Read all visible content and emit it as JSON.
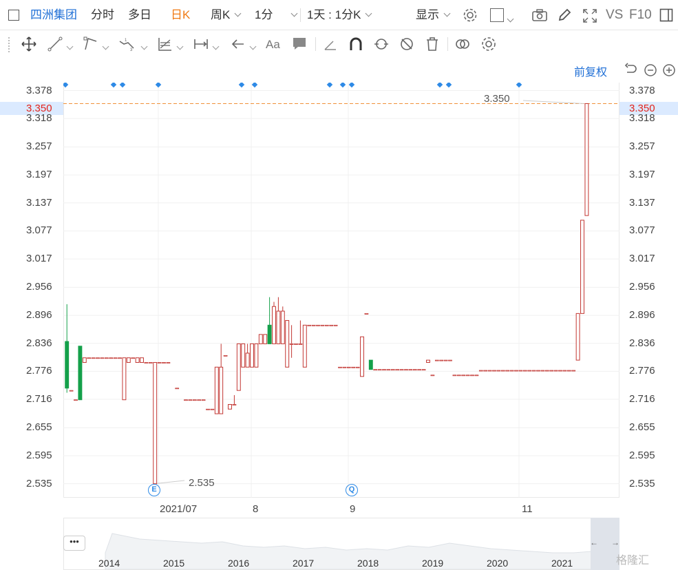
{
  "toolbar": {
    "stock_name": "四洲集团",
    "tab_intraday": "分时",
    "tab_multiday": "多日",
    "tab_daily": "日K",
    "tab_weekly": "周K",
    "tab_minute": "1分",
    "period_combo": "1天 : 1分K",
    "display_label": "显示",
    "vs_label": "VS",
    "f10_label": "F10"
  },
  "chart_toolbar": {
    "adjust_label": "前复权"
  },
  "y_axis": {
    "ticks": [
      "3.378",
      "3.318",
      "3.257",
      "3.197",
      "3.137",
      "3.077",
      "3.017",
      "2.956",
      "2.896",
      "2.836",
      "2.776",
      "2.716",
      "2.655",
      "2.595",
      "2.535"
    ],
    "current_price": "3.350"
  },
  "x_axis": {
    "ticks": [
      "2021/07",
      "8",
      "9",
      "11"
    ]
  },
  "annotations": {
    "high_label": "3.350",
    "low_label": "2.535",
    "event_e": "E",
    "event_q": "Q"
  },
  "navigator": {
    "more": "•••",
    "years": [
      "2014",
      "2015",
      "2016",
      "2017",
      "2018",
      "2019",
      "2020",
      "2021"
    ],
    "left_arrow": "←",
    "right_arrow": "→"
  },
  "watermark": "格隆汇",
  "colors": {
    "up": "#c23531",
    "down": "#14a04a",
    "accent": "#1f6fd6",
    "active_tab": "#f07a13",
    "price_line": "#f09038",
    "price_text": "#e2231a"
  },
  "chart_data": {
    "type": "candlestick",
    "ylim": [
      2.505,
      3.395
    ],
    "candles": [
      {
        "x": 0,
        "o": 2.84,
        "h": 2.92,
        "l": 2.73,
        "c": 2.74
      },
      {
        "x": 1,
        "o": 2.735,
        "h": 2.735,
        "l": 2.735,
        "c": 2.735
      },
      {
        "x": 2,
        "o": 2.715,
        "h": 2.715,
        "l": 2.715,
        "c": 2.715
      },
      {
        "x": 3,
        "o": 2.83,
        "h": 2.83,
        "l": 2.715,
        "c": 2.715
      },
      {
        "x": 4,
        "o": 2.795,
        "h": 2.805,
        "l": 2.795,
        "c": 2.805
      },
      {
        "x": 5,
        "o": 2.805,
        "h": 2.805,
        "l": 2.805,
        "c": 2.805
      },
      {
        "x": 6,
        "o": 2.805,
        "h": 2.805,
        "l": 2.805,
        "c": 2.805
      },
      {
        "x": 7,
        "o": 2.805,
        "h": 2.805,
        "l": 2.805,
        "c": 2.805
      },
      {
        "x": 8,
        "o": 2.805,
        "h": 2.805,
        "l": 2.805,
        "c": 2.805
      },
      {
        "x": 9,
        "o": 2.805,
        "h": 2.805,
        "l": 2.805,
        "c": 2.805
      },
      {
        "x": 10,
        "o": 2.805,
        "h": 2.805,
        "l": 2.805,
        "c": 2.805
      },
      {
        "x": 11,
        "o": 2.805,
        "h": 2.805,
        "l": 2.805,
        "c": 2.805
      },
      {
        "x": 12,
        "o": 2.805,
        "h": 2.805,
        "l": 2.805,
        "c": 2.805
      },
      {
        "x": 13,
        "o": 2.715,
        "h": 2.805,
        "l": 2.715,
        "c": 2.805
      },
      {
        "x": 14,
        "o": 2.795,
        "h": 2.805,
        "l": 2.795,
        "c": 2.805
      },
      {
        "x": 15,
        "o": 2.805,
        "h": 2.805,
        "l": 2.805,
        "c": 2.805
      },
      {
        "x": 16,
        "o": 2.795,
        "h": 2.805,
        "l": 2.795,
        "c": 2.805
      },
      {
        "x": 17,
        "o": 2.795,
        "h": 2.805,
        "l": 2.795,
        "c": 2.805
      },
      {
        "x": 18,
        "o": 2.795,
        "h": 2.795,
        "l": 2.795,
        "c": 2.795
      },
      {
        "x": 19,
        "o": 2.795,
        "h": 2.795,
        "l": 2.795,
        "c": 2.795
      },
      {
        "x": 20,
        "o": 2.535,
        "h": 2.795,
        "l": 2.535,
        "c": 2.795
      },
      {
        "x": 21,
        "o": 2.795,
        "h": 2.795,
        "l": 2.795,
        "c": 2.795
      },
      {
        "x": 22,
        "o": 2.795,
        "h": 2.795,
        "l": 2.795,
        "c": 2.795
      },
      {
        "x": 23,
        "o": 2.795,
        "h": 2.795,
        "l": 2.795,
        "c": 2.795
      },
      {
        "x": 25,
        "o": 2.74,
        "h": 2.74,
        "l": 2.74,
        "c": 2.74
      },
      {
        "x": 27,
        "o": 2.715,
        "h": 2.715,
        "l": 2.715,
        "c": 2.715
      },
      {
        "x": 28,
        "o": 2.715,
        "h": 2.715,
        "l": 2.715,
        "c": 2.715
      },
      {
        "x": 29,
        "o": 2.715,
        "h": 2.715,
        "l": 2.715,
        "c": 2.715
      },
      {
        "x": 30,
        "o": 2.715,
        "h": 2.715,
        "l": 2.715,
        "c": 2.715
      },
      {
        "x": 31,
        "o": 2.715,
        "h": 2.715,
        "l": 2.715,
        "c": 2.715
      },
      {
        "x": 32,
        "o": 2.695,
        "h": 2.695,
        "l": 2.695,
        "c": 2.695
      },
      {
        "x": 33,
        "o": 2.695,
        "h": 2.695,
        "l": 2.695,
        "c": 2.695
      },
      {
        "x": 34,
        "o": 2.685,
        "h": 2.785,
        "l": 2.685,
        "c": 2.785
      },
      {
        "x": 35,
        "o": 2.685,
        "h": 2.835,
        "l": 2.685,
        "c": 2.785
      },
      {
        "x": 36,
        "o": 2.81,
        "h": 2.81,
        "l": 2.81,
        "c": 2.81
      },
      {
        "x": 37,
        "o": 2.695,
        "h": 2.705,
        "l": 2.695,
        "c": 2.705
      },
      {
        "x": 38,
        "o": 2.705,
        "h": 2.725,
        "l": 2.705,
        "c": 2.705
      },
      {
        "x": 39,
        "o": 2.735,
        "h": 2.835,
        "l": 2.735,
        "c": 2.835
      },
      {
        "x": 40,
        "o": 2.785,
        "h": 2.835,
        "l": 2.785,
        "c": 2.835
      },
      {
        "x": 41,
        "o": 2.785,
        "h": 2.835,
        "l": 2.785,
        "c": 2.815
      },
      {
        "x": 42,
        "o": 2.785,
        "h": 2.835,
        "l": 2.785,
        "c": 2.835
      },
      {
        "x": 43,
        "o": 2.785,
        "h": 2.835,
        "l": 2.785,
        "c": 2.835
      },
      {
        "x": 44,
        "o": 2.835,
        "h": 2.855,
        "l": 2.835,
        "c": 2.855
      },
      {
        "x": 45,
        "o": 2.835,
        "h": 2.855,
        "l": 2.835,
        "c": 2.855
      },
      {
        "x": 46,
        "o": 2.875,
        "h": 2.935,
        "l": 2.835,
        "c": 2.835
      },
      {
        "x": 47,
        "o": 2.835,
        "h": 2.925,
        "l": 2.835,
        "c": 2.915
      },
      {
        "x": 48,
        "o": 2.835,
        "h": 2.935,
        "l": 2.835,
        "c": 2.905
      },
      {
        "x": 49,
        "o": 2.835,
        "h": 2.915,
        "l": 2.835,
        "c": 2.905
      },
      {
        "x": 50,
        "o": 2.785,
        "h": 2.885,
        "l": 2.785,
        "c": 2.885
      },
      {
        "x": 51,
        "o": 2.835,
        "h": 2.875,
        "l": 2.805,
        "c": 2.835
      },
      {
        "x": 52,
        "o": 2.835,
        "h": 2.835,
        "l": 2.835,
        "c": 2.835
      },
      {
        "x": 53,
        "o": 2.835,
        "h": 2.885,
        "l": 2.835,
        "c": 2.835
      },
      {
        "x": 54,
        "o": 2.785,
        "h": 2.875,
        "l": 2.785,
        "c": 2.875
      },
      {
        "x": 55,
        "o": 2.875,
        "h": 2.875,
        "l": 2.875,
        "c": 2.875
      },
      {
        "x": 56,
        "o": 2.875,
        "h": 2.875,
        "l": 2.875,
        "c": 2.875
      },
      {
        "x": 57,
        "o": 2.875,
        "h": 2.875,
        "l": 2.875,
        "c": 2.875
      },
      {
        "x": 58,
        "o": 2.875,
        "h": 2.875,
        "l": 2.875,
        "c": 2.875
      },
      {
        "x": 59,
        "o": 2.875,
        "h": 2.875,
        "l": 2.875,
        "c": 2.875
      },
      {
        "x": 60,
        "o": 2.875,
        "h": 2.875,
        "l": 2.875,
        "c": 2.875
      },
      {
        "x": 61,
        "o": 2.875,
        "h": 2.875,
        "l": 2.875,
        "c": 2.875
      },
      {
        "x": 62,
        "o": 2.785,
        "h": 2.785,
        "l": 2.785,
        "c": 2.785
      },
      {
        "x": 63,
        "o": 2.785,
        "h": 2.785,
        "l": 2.785,
        "c": 2.785
      },
      {
        "x": 64,
        "o": 2.785,
        "h": 2.785,
        "l": 2.785,
        "c": 2.785
      },
      {
        "x": 65,
        "o": 2.785,
        "h": 2.785,
        "l": 2.785,
        "c": 2.785
      },
      {
        "x": 66,
        "o": 2.785,
        "h": 2.785,
        "l": 2.785,
        "c": 2.785
      },
      {
        "x": 67,
        "o": 2.765,
        "h": 2.85,
        "l": 2.765,
        "c": 2.85
      },
      {
        "x": 68,
        "o": 2.9,
        "h": 2.9,
        "l": 2.9,
        "c": 2.9
      },
      {
        "x": 69,
        "o": 2.8,
        "h": 2.8,
        "l": 2.78,
        "c": 2.78
      },
      {
        "x": 70,
        "o": 2.78,
        "h": 2.78,
        "l": 2.78,
        "c": 2.78
      },
      {
        "x": 71,
        "o": 2.78,
        "h": 2.78,
        "l": 2.78,
        "c": 2.78
      },
      {
        "x": 72,
        "o": 2.78,
        "h": 2.78,
        "l": 2.78,
        "c": 2.78
      },
      {
        "x": 73,
        "o": 2.78,
        "h": 2.78,
        "l": 2.78,
        "c": 2.78
      },
      {
        "x": 74,
        "o": 2.78,
        "h": 2.78,
        "l": 2.78,
        "c": 2.78
      },
      {
        "x": 75,
        "o": 2.78,
        "h": 2.78,
        "l": 2.78,
        "c": 2.78
      },
      {
        "x": 76,
        "o": 2.78,
        "h": 2.78,
        "l": 2.78,
        "c": 2.78
      },
      {
        "x": 77,
        "o": 2.78,
        "h": 2.78,
        "l": 2.78,
        "c": 2.78
      },
      {
        "x": 78,
        "o": 2.78,
        "h": 2.78,
        "l": 2.78,
        "c": 2.78
      },
      {
        "x": 79,
        "o": 2.78,
        "h": 2.78,
        "l": 2.78,
        "c": 2.78
      },
      {
        "x": 80,
        "o": 2.78,
        "h": 2.78,
        "l": 2.78,
        "c": 2.78
      },
      {
        "x": 81,
        "o": 2.78,
        "h": 2.78,
        "l": 2.78,
        "c": 2.78
      },
      {
        "x": 82,
        "o": 2.795,
        "h": 2.8,
        "l": 2.795,
        "c": 2.8
      },
      {
        "x": 83,
        "o": 2.768,
        "h": 2.768,
        "l": 2.768,
        "c": 2.768
      },
      {
        "x": 84,
        "o": 2.8,
        "h": 2.8,
        "l": 2.8,
        "c": 2.8
      },
      {
        "x": 85,
        "o": 2.8,
        "h": 2.8,
        "l": 2.8,
        "c": 2.8
      },
      {
        "x": 86,
        "o": 2.8,
        "h": 2.8,
        "l": 2.8,
        "c": 2.8
      },
      {
        "x": 87,
        "o": 2.8,
        "h": 2.8,
        "l": 2.8,
        "c": 2.8
      },
      {
        "x": 88,
        "o": 2.768,
        "h": 2.768,
        "l": 2.768,
        "c": 2.768
      },
      {
        "x": 89,
        "o": 2.768,
        "h": 2.768,
        "l": 2.768,
        "c": 2.768
      },
      {
        "x": 90,
        "o": 2.768,
        "h": 2.768,
        "l": 2.768,
        "c": 2.768
      },
      {
        "x": 91,
        "o": 2.768,
        "h": 2.768,
        "l": 2.768,
        "c": 2.768
      },
      {
        "x": 92,
        "o": 2.768,
        "h": 2.768,
        "l": 2.768,
        "c": 2.768
      },
      {
        "x": 93,
        "o": 2.768,
        "h": 2.768,
        "l": 2.768,
        "c": 2.768
      },
      {
        "x": 94,
        "o": 2.778,
        "h": 2.778,
        "l": 2.778,
        "c": 2.778
      },
      {
        "x": 95,
        "o": 2.778,
        "h": 2.778,
        "l": 2.778,
        "c": 2.778
      },
      {
        "x": 96,
        "o": 2.778,
        "h": 2.778,
        "l": 2.778,
        "c": 2.778
      },
      {
        "x": 97,
        "o": 2.778,
        "h": 2.778,
        "l": 2.778,
        "c": 2.778
      },
      {
        "x": 98,
        "o": 2.778,
        "h": 2.778,
        "l": 2.778,
        "c": 2.778
      },
      {
        "x": 99,
        "o": 2.778,
        "h": 2.778,
        "l": 2.778,
        "c": 2.778
      },
      {
        "x": 100,
        "o": 2.778,
        "h": 2.778,
        "l": 2.778,
        "c": 2.778
      },
      {
        "x": 101,
        "o": 2.778,
        "h": 2.778,
        "l": 2.778,
        "c": 2.778
      },
      {
        "x": 102,
        "o": 2.778,
        "h": 2.778,
        "l": 2.778,
        "c": 2.778
      },
      {
        "x": 103,
        "o": 2.778,
        "h": 2.778,
        "l": 2.778,
        "c": 2.778
      },
      {
        "x": 104,
        "o": 2.778,
        "h": 2.778,
        "l": 2.778,
        "c": 2.778
      },
      {
        "x": 105,
        "o": 2.778,
        "h": 2.778,
        "l": 2.778,
        "c": 2.778
      },
      {
        "x": 106,
        "o": 2.778,
        "h": 2.778,
        "l": 2.778,
        "c": 2.778
      },
      {
        "x": 107,
        "o": 2.778,
        "h": 2.778,
        "l": 2.778,
        "c": 2.778
      },
      {
        "x": 108,
        "o": 2.778,
        "h": 2.778,
        "l": 2.778,
        "c": 2.778
      },
      {
        "x": 109,
        "o": 2.778,
        "h": 2.778,
        "l": 2.778,
        "c": 2.778
      },
      {
        "x": 110,
        "o": 2.778,
        "h": 2.778,
        "l": 2.778,
        "c": 2.778
      },
      {
        "x": 111,
        "o": 2.778,
        "h": 2.778,
        "l": 2.778,
        "c": 2.778
      },
      {
        "x": 112,
        "o": 2.778,
        "h": 2.778,
        "l": 2.778,
        "c": 2.778
      },
      {
        "x": 113,
        "o": 2.778,
        "h": 2.778,
        "l": 2.778,
        "c": 2.778
      },
      {
        "x": 114,
        "o": 2.778,
        "h": 2.778,
        "l": 2.778,
        "c": 2.778
      },
      {
        "x": 115,
        "o": 2.778,
        "h": 2.778,
        "l": 2.778,
        "c": 2.778
      },
      {
        "x": 116,
        "o": 2.8,
        "h": 2.9,
        "l": 2.8,
        "c": 2.9
      },
      {
        "x": 117,
        "o": 2.9,
        "h": 3.1,
        "l": 2.9,
        "c": 3.1
      },
      {
        "x": 118,
        "o": 3.11,
        "h": 3.35,
        "l": 3.11,
        "c": 3.35
      }
    ],
    "slot_count": 125
  }
}
